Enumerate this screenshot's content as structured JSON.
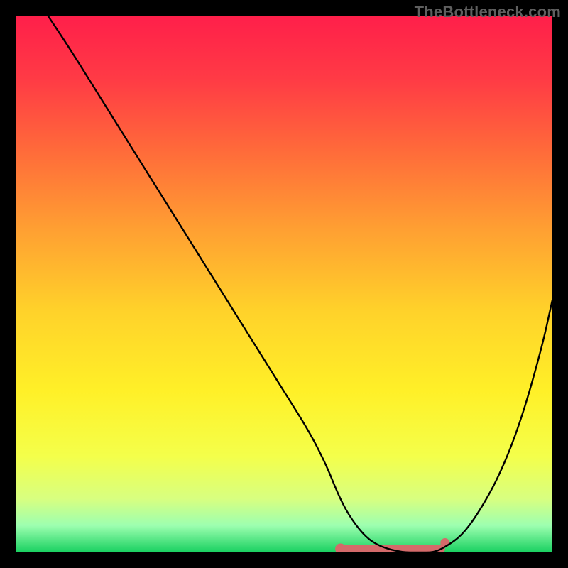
{
  "watermark": "TheBottleneck.com",
  "gradient": {
    "stops": [
      {
        "offset": 0.0,
        "color": "#ff1f4a"
      },
      {
        "offset": 0.12,
        "color": "#ff3b45"
      },
      {
        "offset": 0.25,
        "color": "#ff6a3a"
      },
      {
        "offset": 0.4,
        "color": "#ffa032"
      },
      {
        "offset": 0.55,
        "color": "#ffd22a"
      },
      {
        "offset": 0.7,
        "color": "#fff028"
      },
      {
        "offset": 0.82,
        "color": "#f4ff4a"
      },
      {
        "offset": 0.9,
        "color": "#d8ff80"
      },
      {
        "offset": 0.95,
        "color": "#9dffb0"
      },
      {
        "offset": 1.0,
        "color": "#18d060"
      }
    ]
  },
  "chart_data": {
    "type": "line",
    "title": "",
    "xlabel": "",
    "ylabel": "",
    "xlim": [
      0,
      100
    ],
    "ylim": [
      0,
      100
    ],
    "series": [
      {
        "name": "curve",
        "x": [
          6,
          10,
          15,
          20,
          25,
          30,
          35,
          40,
          45,
          50,
          55,
          58,
          60,
          62,
          65,
          68,
          72,
          75,
          78,
          80,
          83,
          86,
          90,
          94,
          98,
          100
        ],
        "y": [
          100,
          94,
          86,
          78,
          70,
          62,
          54,
          46,
          38,
          30,
          22,
          16,
          11,
          7,
          3,
          1,
          0,
          0,
          0,
          1,
          3,
          7,
          14,
          24,
          38,
          47
        ]
      }
    ],
    "flat_band": {
      "x_start": 60,
      "x_end": 80,
      "marker_color": "#d46a6a",
      "dot_x": 80,
      "dot_y": 1
    }
  }
}
